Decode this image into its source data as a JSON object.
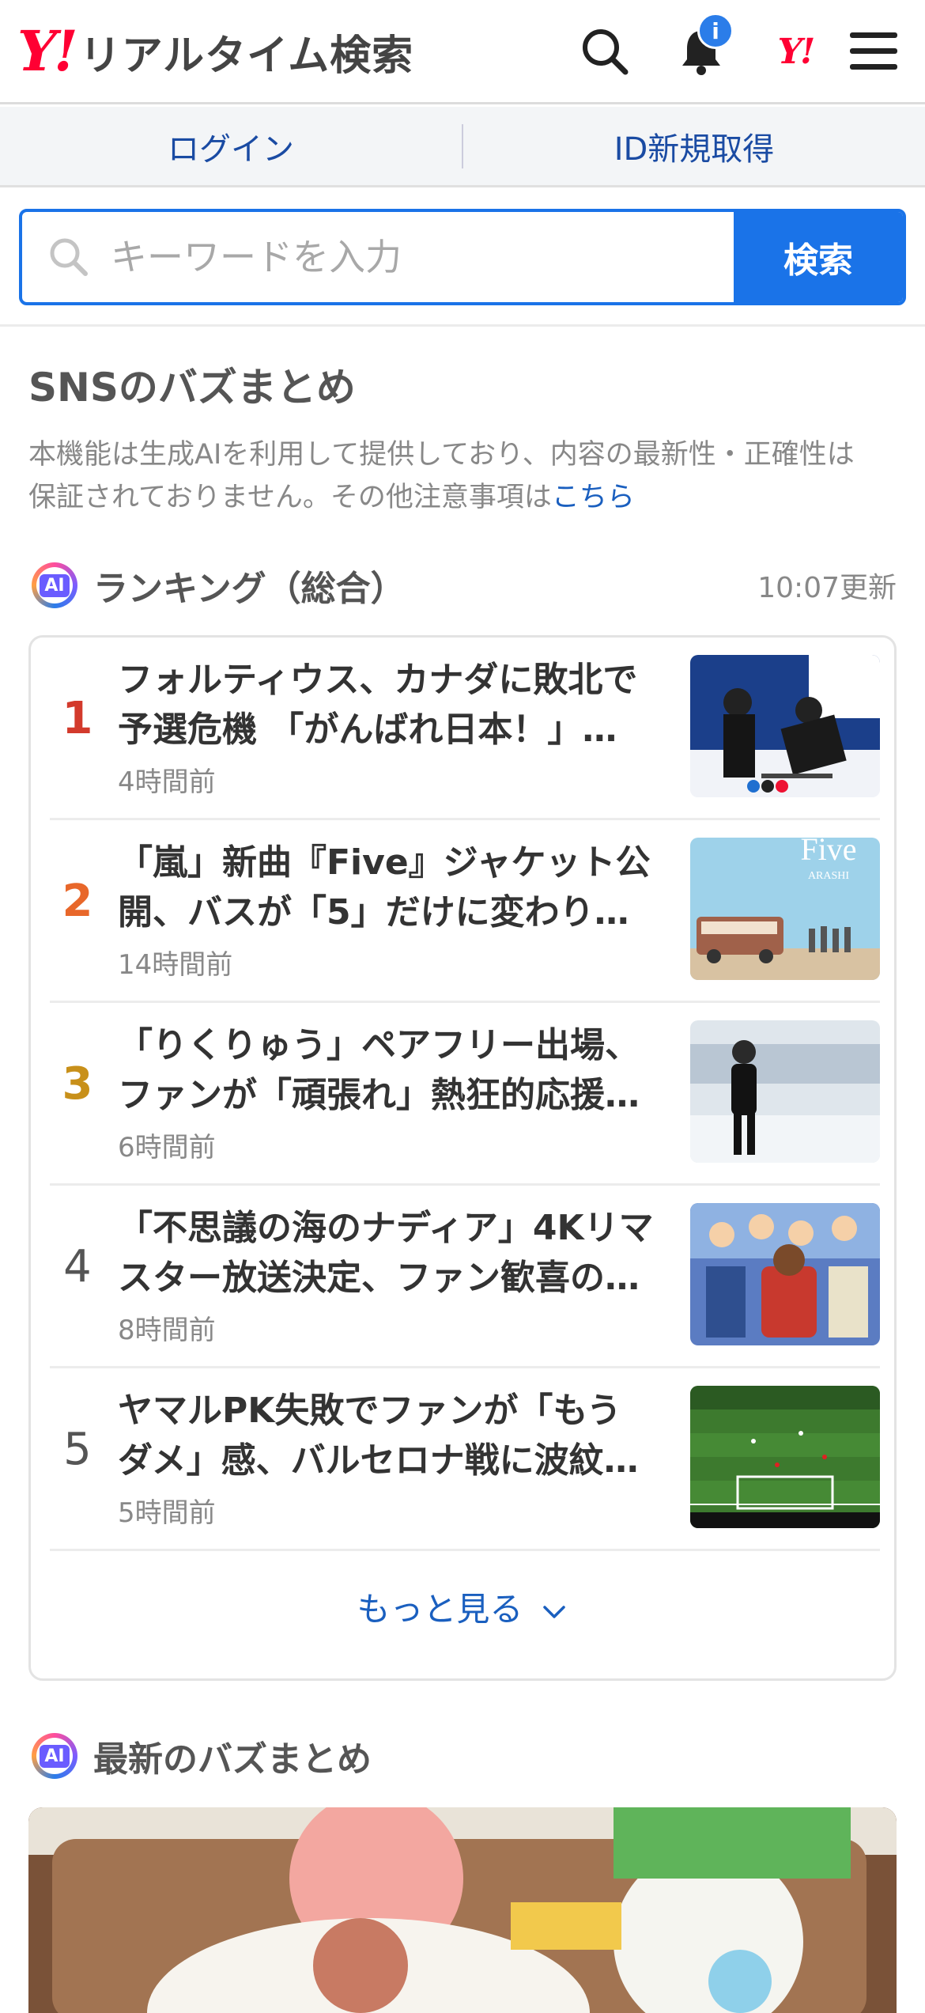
{
  "header": {
    "logo_mark": "Y!",
    "logo_text": "リアルタイム検索",
    "notification_badge": "i",
    "yj_mark": "Y!"
  },
  "auth": {
    "login_label": "ログイン",
    "register_label": "ID新規取得"
  },
  "search": {
    "placeholder": "キーワードを入力",
    "button_label": "検索"
  },
  "sns": {
    "title": "SNSのバズまとめ",
    "notice_line1": "本機能は生成AIを利用して提供しており、内容の最新性・正確性は",
    "notice_line2_text": "保証されておりません。その他注意事項は",
    "notice_link": "こちら"
  },
  "ranking": {
    "ai_label": "AI",
    "title": "ランキング（総合）",
    "updated": "10:07更新",
    "items": [
      {
        "rank": "1",
        "rank_color": "#d33a2c",
        "line1": "フォルティウス、カナダに敗北で",
        "line2": "予選危機 「がんばれ日本！」…",
        "time": "4時間前",
        "thumb": "curling"
      },
      {
        "rank": "2",
        "rank_color": "#e8672a",
        "line1": "「嵐」新曲『Five』ジャケット公",
        "line2": "開、バスが「5」だけに変わり…",
        "time": "14時間前",
        "thumb": "five",
        "thumb_text": "Five",
        "thumb_sub": "ARASHI"
      },
      {
        "rank": "3",
        "rank_color": "#c8901a",
        "line1": "「りくりゅう」ペアフリー出場、",
        "line2": "ファンが「頑張れ」熱狂的応援…",
        "time": "6時間前",
        "thumb": "skating"
      },
      {
        "rank": "4",
        "rank_color": "#555555",
        "line1": "「不思議の海のナディア」4Kリマ",
        "line2": "スター放送決定、ファン歓喜の…",
        "time": "8時間前",
        "thumb": "anime"
      },
      {
        "rank": "5",
        "rank_color": "#555555",
        "line1": "ヤマルPK失敗でファンが「もう",
        "line2": "ダメ」感、バルセロナ戦に波紋…",
        "time": "5時間前",
        "thumb": "soccer"
      }
    ],
    "more_label": "もっと見る"
  },
  "latest": {
    "ai_label": "AI",
    "title": "最新のバズまとめ"
  }
}
